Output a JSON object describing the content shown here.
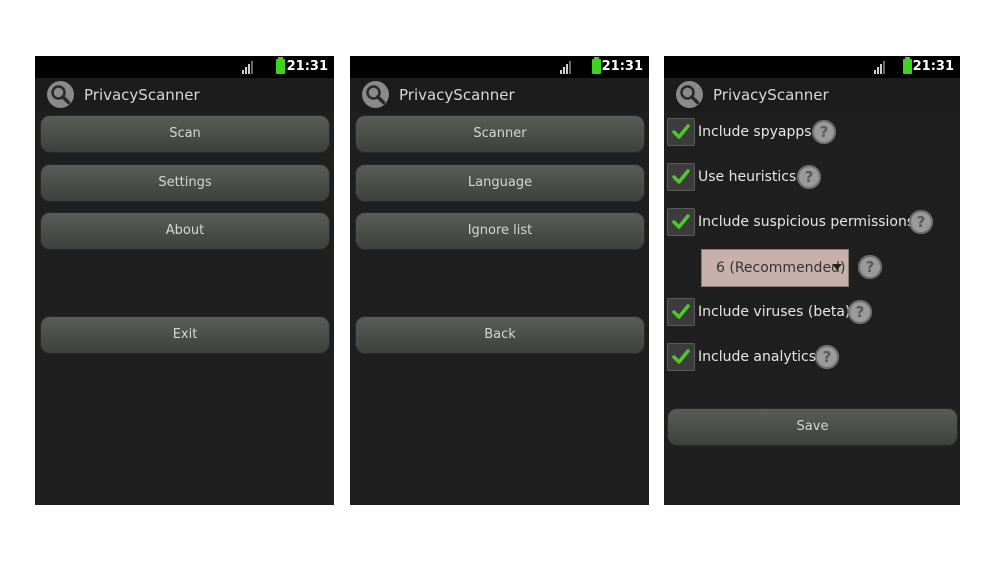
{
  "screens": [
    {
      "status": {
        "time": "21:31"
      },
      "app_title": "PrivacyScanner",
      "buttons": {
        "scan": "Scan",
        "settings": "Settings",
        "about": "About",
        "exit": "Exit"
      }
    },
    {
      "status": {
        "time": "21:31"
      },
      "app_title": "PrivacyScanner",
      "buttons": {
        "scanner": "Scanner",
        "language": "Language",
        "ignore_list": "Ignore list",
        "back": "Back"
      }
    },
    {
      "status": {
        "time": "21:31"
      },
      "app_title": "PrivacyScanner",
      "options": [
        {
          "label": "Include spyapps",
          "checked": true
        },
        {
          "label": "Use heuristics",
          "checked": true
        },
        {
          "label": "Include suspicious permissions",
          "checked": true
        },
        {
          "label": "Include viruses (beta)",
          "checked": true
        },
        {
          "label": "Include analytics",
          "checked": true
        }
      ],
      "permission_level": {
        "selected": "6 (Recommended)"
      },
      "save_label": "Save"
    }
  ],
  "icons": {
    "app": "magnifier-icon",
    "signal": "signal-icon",
    "battery": "battery-icon",
    "check": "checkmark-icon",
    "help": "help-icon",
    "help_glyph": "?"
  },
  "colors": {
    "screen_bg": "#1f1f1f",
    "battery": "#3fd21e",
    "check": "#4ec82a",
    "select_bg": "#c8b1ad"
  }
}
